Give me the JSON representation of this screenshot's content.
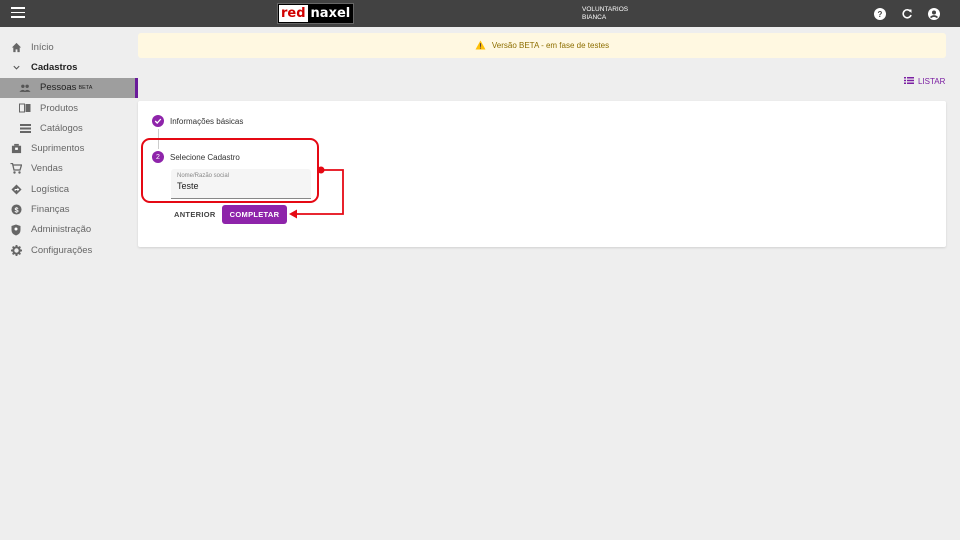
{
  "header": {
    "logo_red": "red",
    "logo_naxel": "naxel",
    "org_line1": "VOLUNTARIOS",
    "org_line2": "BIANCA",
    "icons": [
      "help-icon",
      "refresh-icon",
      "account-icon"
    ]
  },
  "sidebar": {
    "items": [
      {
        "label": "Início",
        "icon": "home-icon"
      },
      {
        "label": "Cadastros",
        "icon": "chevron-down-icon"
      },
      {
        "label": "Pessoas",
        "badge": "BETA",
        "icon": "people-icon"
      },
      {
        "label": "Produtos",
        "icon": "book-icon"
      },
      {
        "label": "Catálogos",
        "icon": "list-icon"
      },
      {
        "label": "Suprimentos",
        "icon": "box-icon"
      },
      {
        "label": "Vendas",
        "icon": "cart-icon"
      },
      {
        "label": "Logística",
        "icon": "route-icon"
      },
      {
        "label": "Finanças",
        "icon": "dollar-icon"
      },
      {
        "label": "Administração",
        "icon": "shield-icon"
      },
      {
        "label": "Configurações",
        "icon": "gear-icon"
      }
    ]
  },
  "banner": {
    "text": "Versão BETA - em fase de testes"
  },
  "toolbar": {
    "listar_label": "LISTAR"
  },
  "stepper": {
    "steps": [
      {
        "label": "Informações básicas",
        "status": "done"
      },
      {
        "label": "Selecione Cadastro",
        "number": "2",
        "status": "active"
      }
    ],
    "field": {
      "label": "Nome/Razão social",
      "value": "Teste"
    },
    "anterior_label": "ANTERIOR",
    "completar_label": "COMPLETAR"
  },
  "colors": {
    "accent": "#8e24aa",
    "topbar": "#424242",
    "annotation": "#e50914",
    "banner_bg": "#fff8e1"
  }
}
